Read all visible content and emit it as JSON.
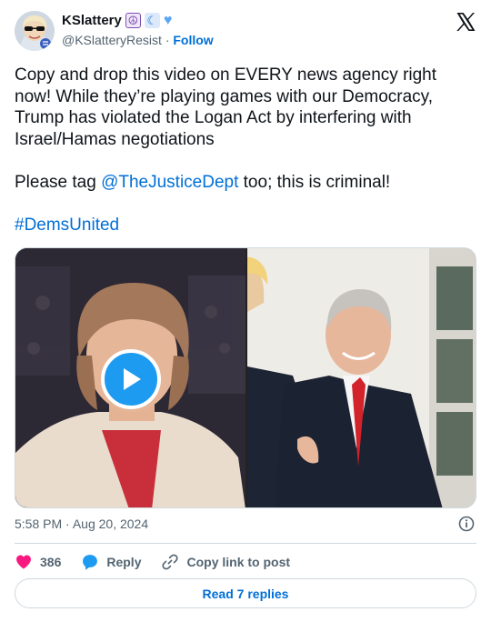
{
  "author": {
    "display_name": "KSlattery",
    "emojis": [
      "☮",
      "☾",
      "♥"
    ],
    "handle": "@KSlatteryResist",
    "separator": "·",
    "follow_label": "Follow"
  },
  "tweet": {
    "line1": "Copy and drop this video on EVERY news agency right now! While they’re playing games with our Democracy, Trump has violated the Logan Act by interfering with Israel/Hamas negotiations",
    "line2_prefix": "Please tag ",
    "line2_mention": "@TheJusticeDept",
    "line2_suffix": " too; this is criminal!",
    "hashtag": "#DemsUnited"
  },
  "media": {
    "left_icon": "play-icon",
    "right_icon": "photo"
  },
  "meta": {
    "time": "5:58 PM",
    "separator": "·",
    "date": "Aug 20, 2024"
  },
  "actions": {
    "like_count": "386",
    "reply_label": "Reply",
    "copy_label": "Copy link to post"
  },
  "read_replies_label": "Read 7 replies",
  "colors": {
    "link": "#006fd6",
    "like": "#f91880",
    "reply": "#1d9bf0",
    "play": "#1d9bf0",
    "text": "#0f1419",
    "muted": "#536471"
  }
}
